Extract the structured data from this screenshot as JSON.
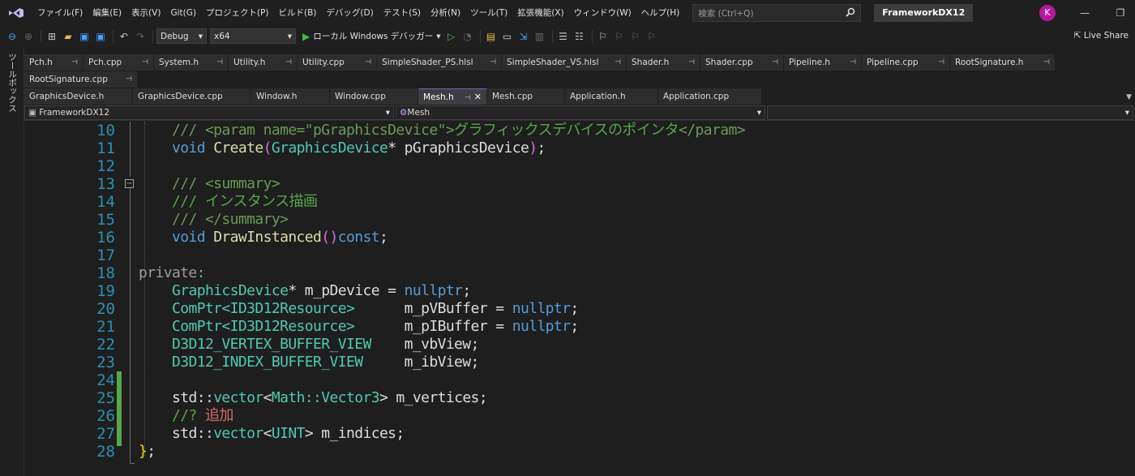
{
  "menu": {
    "items": [
      "ファイル(F)",
      "編集(E)",
      "表示(V)",
      "Git(G)",
      "プロジェクト(P)",
      "ビルド(B)",
      "デバッグ(D)",
      "テスト(S)",
      "分析(N)",
      "ツール(T)",
      "拡張機能(X)",
      "ウィンドウ(W)",
      "ヘルプ(H)"
    ],
    "search_placeholder": "検索 (Ctrl+Q)",
    "solution_name": "FrameworkDX12",
    "avatar_letter": "K",
    "minimize": "—",
    "restore": "❐"
  },
  "toolbar": {
    "config": "Debug",
    "platform": "x64",
    "run_label": "ローカル Windows デバッガー",
    "live_share": "Live Share"
  },
  "toolbox": {
    "label": "ツールボックス"
  },
  "tabs": {
    "row1": [
      "Pch.h",
      "Pch.cpp",
      "System.h",
      "Utility.h",
      "Utility.cpp",
      "SimpleShader_PS.hlsl",
      "SimpleShader_VS.hlsl",
      "Shader.h",
      "Shader.cpp",
      "Pipeline.h",
      "Pipeline.cpp",
      "RootSignature.h"
    ],
    "row2": [
      "RootSignature.cpp"
    ],
    "row3": [
      "GraphicsDevice.h",
      "GraphicsDevice.cpp",
      "Window.h",
      "Window.cpp",
      "Mesh.h",
      "Mesh.cpp",
      "Application.h",
      "Application.cpp"
    ],
    "active": "Mesh.h",
    "pin_glyph": "⊣"
  },
  "navbar": {
    "project": "FrameworkDX12",
    "scope": "Mesh",
    "member": ""
  },
  "editor": {
    "line_numbers": [
      "10",
      "11",
      "12",
      "13",
      "14",
      "15",
      "16",
      "17",
      "18",
      "19",
      "20",
      "21",
      "22",
      "23",
      "24",
      "25",
      "26",
      "27",
      "28"
    ],
    "code": {
      "l10_a": "/// <param name=\"pGraphicsDevice\">",
      "l10_b": "グラフィックスデバイスのポインタ",
      "l10_c": "</param>",
      "l11_void": "void ",
      "l11_fn": "Create",
      "l11_type": "GraphicsDevice",
      "l11_rest": "* pGraphicsDevice",
      "l13": "/// <summary>",
      "l14": "/// インスタンス描画",
      "l15": "/// </summary>",
      "l16_void": "void ",
      "l16_fn": "DrawInstanced",
      "l16_const": "const",
      "l18": "private:",
      "l19_type": "GraphicsDevice",
      "l19_rest": "* m_pDevice = ",
      "l19_null": "nullptr",
      "l20_type": "ComPtr<ID3D12Resource>",
      "l20_rest": "      m_pVBuffer = ",
      "l20_null": "nullptr",
      "l21_type": "ComPtr<ID3D12Resource>",
      "l21_rest": "      m_pIBuffer = ",
      "l21_null": "nullptr",
      "l22_type": "D3D12_VERTEX_BUFFER_VIEW",
      "l22_rest": "    m_vbView;",
      "l23_type": "D3D12_INDEX_BUFFER_VIEW",
      "l23_rest": "     m_ibView;",
      "l25_a": "std::",
      "l25_type1": "vector",
      "l25_b": "<",
      "l25_type2": "Math::Vector3",
      "l25_c": "> m_vertices;",
      "l26_a": "//? ",
      "l26_b": "追加",
      "l27_a": "std::",
      "l27_type1": "vector",
      "l27_b": "<",
      "l27_type2": "UINT",
      "l27_c": "> m_indices;",
      "l28_brace": "}",
      "l28_semi": ";"
    }
  },
  "colors": {
    "comment": "#57a64a",
    "type": "#4ec9b0",
    "keyword": "#569cd6",
    "function": "#dcdcaa",
    "line_number": "#2b91af",
    "change_bar": "#57a64a",
    "active_tab_accent": "#7e57c2"
  }
}
